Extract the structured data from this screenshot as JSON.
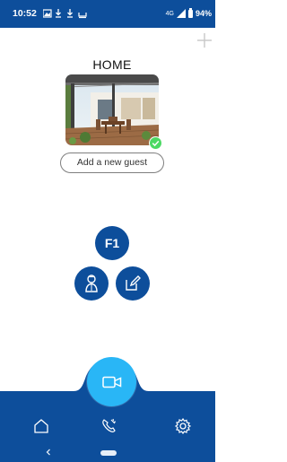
{
  "status_bar": {
    "time": "10:52",
    "network": "4G",
    "battery": "94%"
  },
  "header": {
    "title": "HOME"
  },
  "guest": {
    "add_label": "Add a new guest"
  },
  "floor": {
    "label": "F1"
  },
  "colors": {
    "primary": "#0d4e9b",
    "accent": "#29b6f6",
    "success": "#4cd964"
  },
  "nav": {
    "items": [
      {
        "icon": "home-icon"
      },
      {
        "icon": "phone-settings-icon"
      },
      {
        "icon": "gear-icon"
      }
    ]
  }
}
